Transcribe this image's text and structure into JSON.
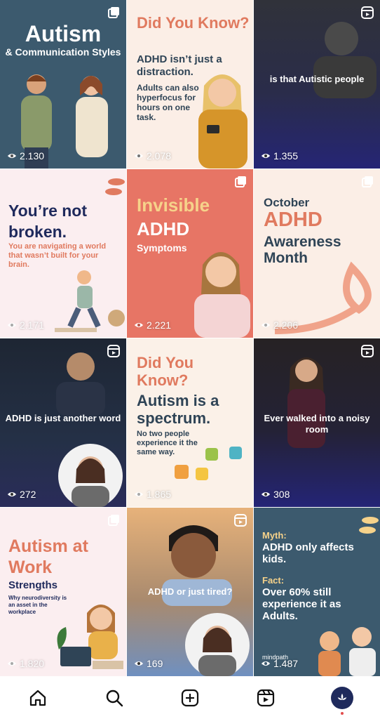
{
  "posts": [
    {
      "type": "carousel",
      "title": "Autism",
      "subtitle": "& Communication Styles",
      "views": "2.130"
    },
    {
      "type": "carousel",
      "heading": "Did You Know?",
      "line1": "ADHD isn’t just a distraction.",
      "line2": "Adults can also hyperfocus for hours on one task.",
      "views": "2.078"
    },
    {
      "type": "reel",
      "caption": "is that Autistic people",
      "views": "1.355"
    },
    {
      "type": "carousel",
      "title": "You’re not broken.",
      "body": "You are navigating a world that wasn’t built for your brain.",
      "views": "2.171"
    },
    {
      "type": "carousel",
      "title1": "Invisible",
      "title2": "ADHD",
      "subtitle": "Symptoms",
      "views": "2.221"
    },
    {
      "type": "carousel",
      "line1": "October",
      "line2": "ADHD",
      "line3": "Awareness Month",
      "views": "2.206"
    },
    {
      "type": "reel",
      "caption": "ADHD is just another word",
      "views": "272"
    },
    {
      "type": "carousel",
      "heading": "Did You Know?",
      "line1": "Autism is a spectrum.",
      "line2": "No two people experience it the same way.",
      "views": "1.865"
    },
    {
      "type": "reel",
      "caption": "Ever walked into a noisy room",
      "views": "308"
    },
    {
      "type": "carousel",
      "title": "Autism at Work",
      "subtitle": "Strengths",
      "body": "Why neurodiversity is an asset in the workplace",
      "views": "1.820"
    },
    {
      "type": "reel",
      "caption": "ADHD or just tired?",
      "views": "169"
    },
    {
      "type": "carousel",
      "myth_label": "Myth:",
      "myth": "ADHD only affects kids.",
      "fact_label": "Fact:",
      "fact": "Over 60% still experience it as Adults.",
      "brand": "mindpath",
      "views": "1.487"
    }
  ],
  "nav": [
    {
      "icon": "home-icon"
    },
    {
      "icon": "search-icon"
    },
    {
      "icon": "create-icon"
    },
    {
      "icon": "reels-icon"
    },
    {
      "icon": "profile-avatar"
    }
  ],
  "colors": {
    "coral": "#e07a5f",
    "navy": "#1f2a5c",
    "slate": "#3c5a6e",
    "cream": "#fbeee6",
    "yellow": "#f6d28a"
  }
}
